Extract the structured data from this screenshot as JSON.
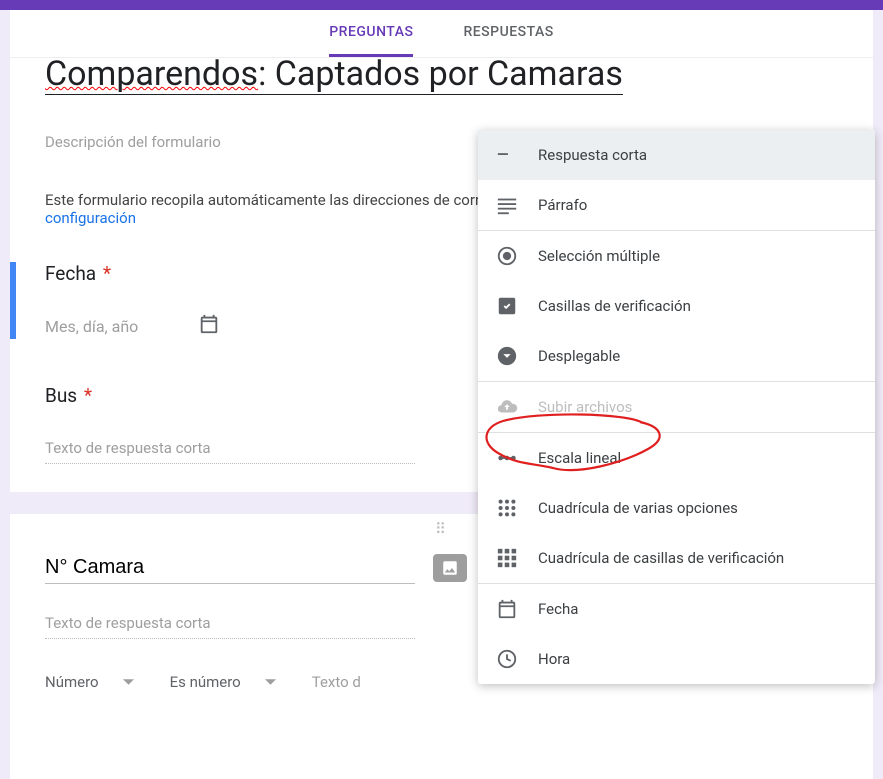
{
  "tabs": {
    "questions": "PREGUNTAS",
    "responses": "RESPUESTAS"
  },
  "form": {
    "title_part1": "Comparendos",
    "title_sep": ": ",
    "title_part2": "Captados por Camaras",
    "description_placeholder": "Descripción del formulario",
    "auto_collect_text": "Este formulario recopila automáticamente las direcciones de correo",
    "config_link": "configuración"
  },
  "q1": {
    "label": "Fecha",
    "required": "*",
    "placeholder": "Mes, día, año"
  },
  "q2": {
    "label": "Bus",
    "required": "*",
    "placeholder": "Texto de respuesta corta"
  },
  "q3": {
    "label_value": "N° Camara",
    "placeholder": "Texto de respuesta corta"
  },
  "validation": {
    "type": "Número",
    "condition": "Es número",
    "error_placeholder": "Texto d"
  },
  "menu": {
    "short_answer": "Respuesta corta",
    "paragraph": "Párrafo",
    "multiple_choice": "Selección múltiple",
    "checkboxes": "Casillas de verificación",
    "dropdown": "Desplegable",
    "file_upload": "Subir archivos",
    "linear_scale": "Escala lineal",
    "mc_grid": "Cuadrícula de varias opciones",
    "cb_grid": "Cuadrícula de casillas de verificación",
    "date": "Fecha",
    "time": "Hora"
  }
}
